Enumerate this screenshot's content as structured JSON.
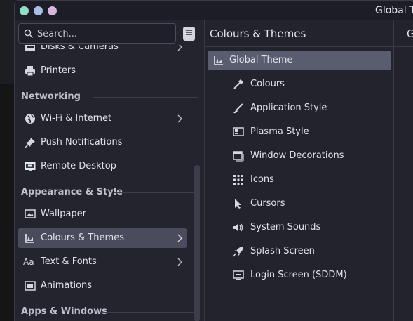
{
  "window": {
    "title": "Global Theme"
  },
  "search": {
    "placeholder": "Search..."
  },
  "sidebar": {
    "items": [
      {
        "label": "Disks & Cameras",
        "icon": "disk-camera-icon",
        "chevron": true
      },
      {
        "label": "Printers",
        "icon": "printer-icon",
        "chevron": false
      },
      {
        "section": "Networking"
      },
      {
        "label": "Wi-Fi & Internet",
        "icon": "globe-icon",
        "chevron": true
      },
      {
        "label": "Push Notifications",
        "icon": "pin-icon",
        "chevron": false
      },
      {
        "label": "Remote Desktop",
        "icon": "remote-desktop-icon",
        "chevron": false
      },
      {
        "section": "Appearance & Style"
      },
      {
        "label": "Wallpaper",
        "icon": "wallpaper-icon",
        "chevron": false
      },
      {
        "label": "Colours & Themes",
        "icon": "colours-themes-icon",
        "chevron": true,
        "selected": true
      },
      {
        "label": "Text & Fonts",
        "icon": "text-fonts-icon",
        "icon_text": "Aa",
        "chevron": true
      },
      {
        "label": "Animations",
        "icon": "animations-icon",
        "chevron": false
      },
      {
        "section": "Apps & Windows"
      }
    ]
  },
  "content": {
    "header": "Colours & Themes",
    "right_header": "G",
    "items": [
      {
        "label": "Global Theme",
        "icon": "global-theme-icon",
        "selected": true
      },
      {
        "label": "Colours",
        "icon": "colour-picker-icon"
      },
      {
        "label": "Application Style",
        "icon": "brush-icon"
      },
      {
        "label": "Plasma Style",
        "icon": "plasma-style-icon"
      },
      {
        "label": "Window Decorations",
        "icon": "window-decorations-icon"
      },
      {
        "label": "Icons",
        "icon": "icons-grid-icon"
      },
      {
        "label": "Cursors",
        "icon": "cursor-icon"
      },
      {
        "label": "System Sounds",
        "icon": "speaker-icon"
      },
      {
        "label": "Splash Screen",
        "icon": "rocket-icon"
      },
      {
        "label": "Login Screen (SDDM)",
        "icon": "login-screen-icon"
      }
    ]
  },
  "colors": {
    "selected": "#4a4c5e",
    "sub_selected": "#5a5c70",
    "background": "#22232d"
  }
}
